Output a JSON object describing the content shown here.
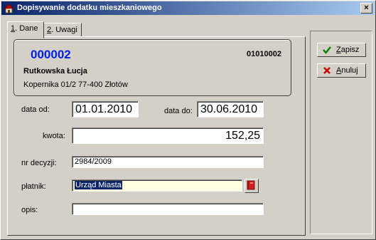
{
  "window": {
    "title": "Dopisywanie dodatku mieszkaniowego"
  },
  "tabs": [
    {
      "prefix": "1",
      "label": ". Dane"
    },
    {
      "prefix": "2",
      "label": ". Uwagi"
    }
  ],
  "client": {
    "number": "000002",
    "code": "01010002",
    "name": "Rutkowska Łucja",
    "address": "Kopernika 01/2 77-400 Złotów"
  },
  "form": {
    "date_from_label": "data od:",
    "date_from_value": "01.01.2010",
    "date_to_label": "data do:",
    "date_to_value": "30.06.2010",
    "amount_label": "kwota:",
    "amount_value": "152,25",
    "decision_label": "nr decyzji:",
    "decision_value": "2984/2009",
    "payer_label": "płatnik:",
    "payer_value": "Urząd Miasta",
    "description_label": "opis:",
    "description_value": ""
  },
  "buttons": {
    "save_mnemonic": "Z",
    "save_rest": "apisz",
    "cancel_mnemonic": "A",
    "cancel_rest": "nuluj"
  },
  "colors": {
    "title_gradient_start": "#0a246a",
    "title_gradient_end": "#a6caf0",
    "client_number": "#0020e0",
    "window_bg": "#d4d0c8",
    "save_icon": "#008000",
    "cancel_icon": "#cc0000"
  },
  "icons": {
    "title": "house-icon",
    "save": "checkmark-icon",
    "cancel": "x-icon",
    "payer_lookup": "book-icon"
  }
}
